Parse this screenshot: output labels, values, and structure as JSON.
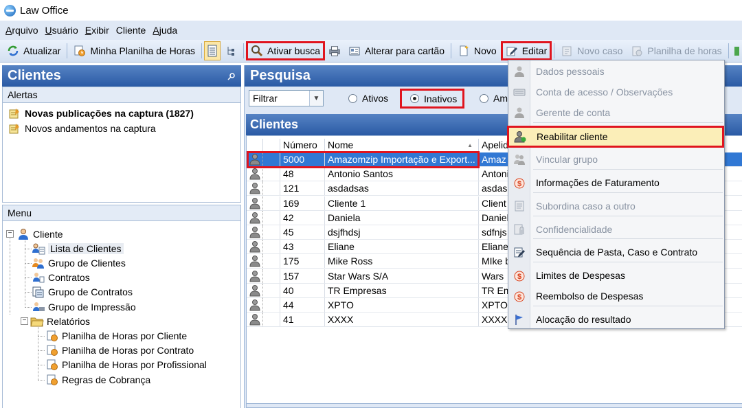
{
  "window": {
    "title": "Law Office"
  },
  "menubar": [
    {
      "label": "Arquivo",
      "key": "A",
      "rest": "rquivo"
    },
    {
      "label": "Usuário",
      "key": "U",
      "rest": "suário"
    },
    {
      "label": "Exibir",
      "key": "E",
      "rest": "xibir"
    },
    {
      "label": "Cliente",
      "key": "",
      "rest": "Cliente"
    },
    {
      "label": "Ajuda",
      "key": "A",
      "rest": "juda"
    }
  ],
  "toolbar": {
    "atualizar": "Atualizar",
    "planilha": "Minha Planilha de Horas",
    "ativar_busca": "Ativar busca",
    "alterar_cartao": "Alterar para cartão",
    "novo": "Novo",
    "editar": "Editar",
    "novo_caso": "Novo caso",
    "planilha_horas": "Planilha de horas"
  },
  "left": {
    "title": "Clientes",
    "alerts_title": "Alertas",
    "alerts": [
      {
        "text": "Novas publicações na captura (1827)",
        "bold": true
      },
      {
        "text": "Novos andamentos na captura",
        "bold": false
      }
    ],
    "menu_title": "Menu",
    "tree": {
      "cliente": "Cliente",
      "lista": "Lista de Clientes",
      "grupo": "Grupo de Clientes",
      "contratos": "Contratos",
      "grupo_contratos": "Grupo de Contratos",
      "grupo_impressao": "Grupo de Impressão",
      "relatorios": "Relatórios",
      "rel1": "Planilha de Horas por Cliente",
      "rel2": "Planilha de Horas por Contrato",
      "rel3": "Planilha de Horas por Profissional",
      "rel4": "Regras de Cobrança"
    }
  },
  "search": {
    "title": "Pesquisa",
    "filter_value": "Filtrar",
    "radio_ativos": "Ativos",
    "radio_inativos": "Inativos",
    "radio_ambos": "Am",
    "selected": "Inativos"
  },
  "clients": {
    "title": "Clientes",
    "columns": {
      "numero": "Número",
      "nome": "Nome",
      "apelido": "Apelid"
    },
    "rows": [
      {
        "numero": "5000",
        "nome": "Amazomzip Importação e Export...",
        "apelido": "Amaz",
        "selected": true
      },
      {
        "numero": "48",
        "nome": "Antonio Santos",
        "apelido": "Antonio"
      },
      {
        "numero": "121",
        "nome": "asdadsas",
        "apelido": "asdasd"
      },
      {
        "numero": "169",
        "nome": "Cliente 1",
        "apelido": "Client"
      },
      {
        "numero": "42",
        "nome": "Daniela",
        "apelido": "Daniel"
      },
      {
        "numero": "45",
        "nome": "dsjfhdsj",
        "apelido": "sdfnjs"
      },
      {
        "numero": "43",
        "nome": "Eliane",
        "apelido": "Eliane"
      },
      {
        "numero": "175",
        "nome": "Mike Ross",
        "apelido": "MIke b"
      },
      {
        "numero": "157",
        "nome": "Star Wars S/A",
        "apelido": "Wars"
      },
      {
        "numero": "40",
        "nome": "TR Empresas",
        "apelido": "TR Em"
      },
      {
        "numero": "44",
        "nome": "XPTO",
        "apelido": "XPTO"
      },
      {
        "numero": "41",
        "nome": "XXXX",
        "apelido": "XXXX"
      }
    ]
  },
  "editar_menu": [
    {
      "label": "Dados pessoais",
      "disabled": true,
      "icon": "person-icon"
    },
    {
      "label": "Conta de acesso / Observações",
      "disabled": true,
      "icon": "keyboard-icon"
    },
    {
      "label": "Gerente de conta",
      "disabled": true,
      "icon": "person-icon"
    },
    {
      "label": "Reabilitar cliente",
      "disabled": false,
      "active": true,
      "icon": "person-restore-icon"
    },
    {
      "label": "Vincular grupo",
      "disabled": true,
      "icon": "group-icon"
    },
    {
      "label": "Informações de Faturamento",
      "disabled": false,
      "icon": "money-icon"
    },
    {
      "label": "Subordina caso a outro",
      "disabled": true,
      "icon": "document-icon"
    },
    {
      "label": "Confidencialidade",
      "disabled": true,
      "icon": "lock-icon"
    },
    {
      "label": "Sequência de Pasta, Caso e Contrato",
      "disabled": false,
      "icon": "edit-document-icon"
    },
    {
      "label": "Limites de Despesas",
      "disabled": false,
      "icon": "money-icon"
    },
    {
      "label": "Reembolso de Despesas",
      "disabled": false,
      "icon": "money-icon"
    },
    {
      "label": "Alocação do resultado",
      "disabled": false,
      "icon": "flag-icon"
    }
  ],
  "colors": {
    "header_blue": "#2a5aa5",
    "selection": "#3178d4",
    "highlight": "#e0141e",
    "active_item": "#fbeeb8"
  }
}
